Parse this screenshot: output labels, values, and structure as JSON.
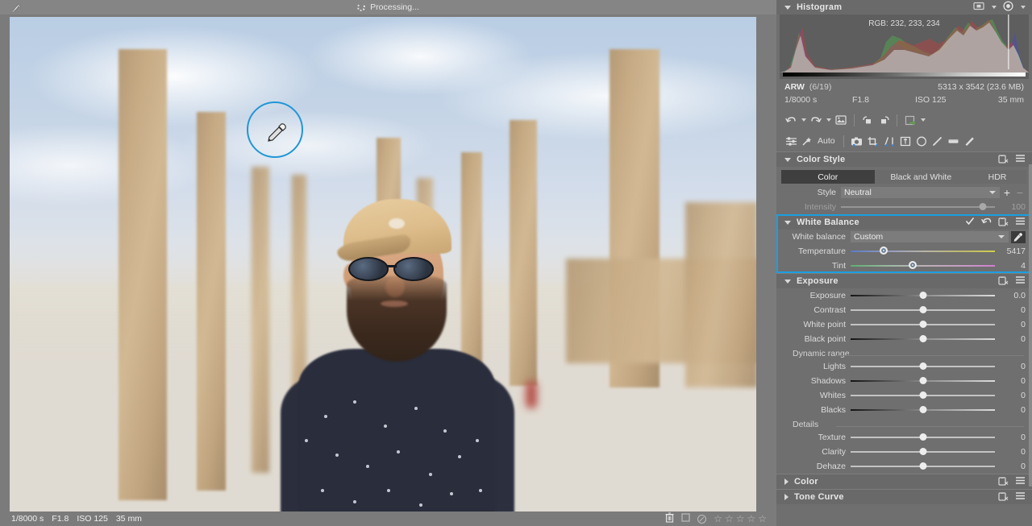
{
  "topbar": {
    "pin_icon": "pin-icon",
    "status_text": "Processing...",
    "spinner_icon": "spinner-icon"
  },
  "viewer": {
    "cursor": {
      "icon": "eyedropper-cursor-icon",
      "color": "#2196d6"
    }
  },
  "statusbar": {
    "exif": [
      "1/8000 s",
      "F1.8",
      "ISO 125",
      "35 mm"
    ],
    "trash_icon": "trash-icon",
    "flag_icon": "flag-icon",
    "reject_icon": "reject-icon",
    "stars": [
      "☆",
      "☆",
      "☆",
      "☆",
      "☆"
    ]
  },
  "histogram": {
    "title": "Histogram",
    "rgb_readout": "RGB: 232, 233, 234",
    "clip_icon": "clipping-toggle-icon",
    "mode_icon": "histogram-mode-icon",
    "caret_icon": "chevron-down-icon"
  },
  "fileinfo": {
    "format": "ARW",
    "index": "(6/19)",
    "dimensions": "5313 x 3542 (23.6 MB)",
    "shutter": "1/8000 s",
    "aperture": "F1.8",
    "iso": "ISO 125",
    "focal": "35 mm"
  },
  "historybar": {
    "undo_icon": "undo-icon",
    "redo_icon": "redo-icon",
    "reset_image_icon": "reset-image-icon",
    "copy_adjustments_icon": "copy-adjustments-icon",
    "paste_adjustments_icon": "paste-adjustments-icon",
    "export_icon": "export-icon"
  },
  "toolbar": {
    "adjustments_icon": "adjustments-sliders-icon",
    "magic_wand_icon": "magic-wand-icon",
    "auto_label": "Auto",
    "tools": [
      "camera-presets-icon",
      "crop-icon",
      "rotate-straighten-icon",
      "perspective-icon",
      "radial-mask-icon",
      "brush-mask-icon",
      "gradient-mask-icon",
      "healing-brush-icon"
    ]
  },
  "color_style": {
    "title": "Color Style",
    "copy_icon": "copy-settings-icon",
    "menu_icon": "hamburger-menu-icon",
    "tabs": [
      {
        "label": "Color",
        "active": true
      },
      {
        "label": "Black and White",
        "active": false
      },
      {
        "label": "HDR",
        "active": false
      }
    ],
    "style_label": "Style",
    "style_value": "Neutral",
    "add_icon": "plus-icon",
    "remove_icon": "minus-icon",
    "intensity_label": "Intensity",
    "intensity_value": "100",
    "intensity_pct": 92
  },
  "white_balance": {
    "title": "White Balance",
    "highlight_color": "#1a9fe0",
    "enabled_icon": "checkmark-icon",
    "reset_icon": "reset-arrow-icon",
    "copy_icon": "copy-settings-icon",
    "menu_icon": "hamburger-menu-icon",
    "wb_label": "White balance",
    "wb_value": "Custom",
    "picker_icon": "eyedropper-icon",
    "sliders": [
      {
        "label": "Temperature",
        "value": "5417",
        "pct": 23,
        "track": "temp"
      },
      {
        "label": "Tint",
        "value": "4",
        "pct": 43,
        "track": "tint"
      }
    ]
  },
  "exposure": {
    "title": "Exposure",
    "copy_icon": "copy-settings-icon",
    "menu_icon": "hamburger-menu-icon",
    "sliders": [
      {
        "label": "Exposure",
        "value": "0.0",
        "pct": 50,
        "track": "dark"
      },
      {
        "label": "Contrast",
        "value": "0",
        "pct": 50,
        "track": "plain"
      },
      {
        "label": "White point",
        "value": "0",
        "pct": 50,
        "track": "plain"
      },
      {
        "label": "Black point",
        "value": "0",
        "pct": 50,
        "track": "dark"
      }
    ],
    "dynamic_range_label": "Dynamic range",
    "dynamic_sliders": [
      {
        "label": "Lights",
        "value": "0",
        "pct": 50,
        "track": "plain"
      },
      {
        "label": "Shadows",
        "value": "0",
        "pct": 50,
        "track": "dark"
      },
      {
        "label": "Whites",
        "value": "0",
        "pct": 50,
        "track": "plain"
      },
      {
        "label": "Blacks",
        "value": "0",
        "pct": 50,
        "track": "dark"
      }
    ],
    "details_label": "Details",
    "detail_sliders": [
      {
        "label": "Texture",
        "value": "0",
        "pct": 50,
        "track": "plain"
      },
      {
        "label": "Clarity",
        "value": "0",
        "pct": 50,
        "track": "plain"
      },
      {
        "label": "Dehaze",
        "value": "0",
        "pct": 50,
        "track": "plain"
      }
    ]
  },
  "collapsed_sections": [
    {
      "title": "Color",
      "copy_icon": "copy-settings-icon",
      "menu_icon": "hamburger-menu-icon"
    },
    {
      "title": "Tone Curve",
      "copy_icon": "copy-settings-icon",
      "menu_icon": "hamburger-menu-icon"
    }
  ]
}
